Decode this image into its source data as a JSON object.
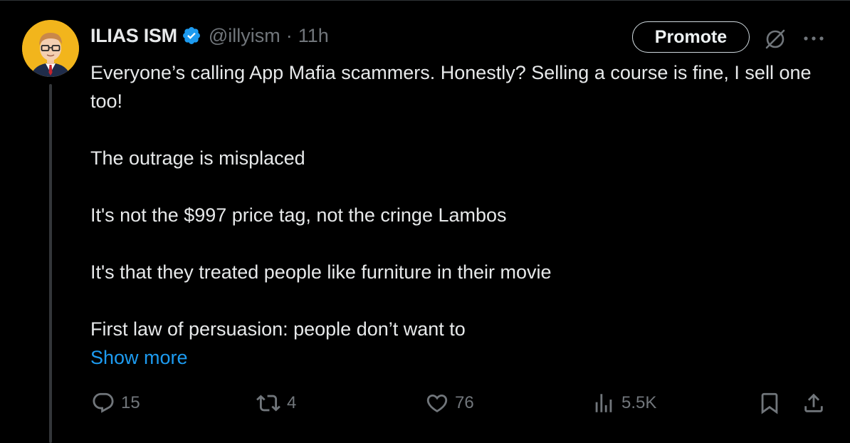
{
  "author": {
    "display_name": "ILIAS ISM",
    "handle": "@illyism",
    "separator": "·",
    "time": "11h",
    "verified": true
  },
  "header_actions": {
    "promote_label": "Promote",
    "grok_icon": "grok-slash-icon",
    "more_icon": "more-dots-icon"
  },
  "tweet": {
    "paragraphs": [
      "Everyone’s calling App Mafia scammers. Honestly? Selling a course is fine, I sell one too!",
      "The outrage is misplaced",
      "It's not the $997 price tag, not the cringe Lambos",
      "It's that they treated people like furniture in their movie",
      "First law of persuasion: people don’t want to"
    ],
    "show_more_label": "Show more"
  },
  "actions": {
    "replies": "15",
    "reposts": "4",
    "likes": "76",
    "views": "5.5K"
  },
  "colors": {
    "background": "#000000",
    "text": "#e7e9ea",
    "muted": "#71767b",
    "accent": "#1d9bf0",
    "avatar_bg": "#f2b51c",
    "thread_line": "#333639"
  }
}
